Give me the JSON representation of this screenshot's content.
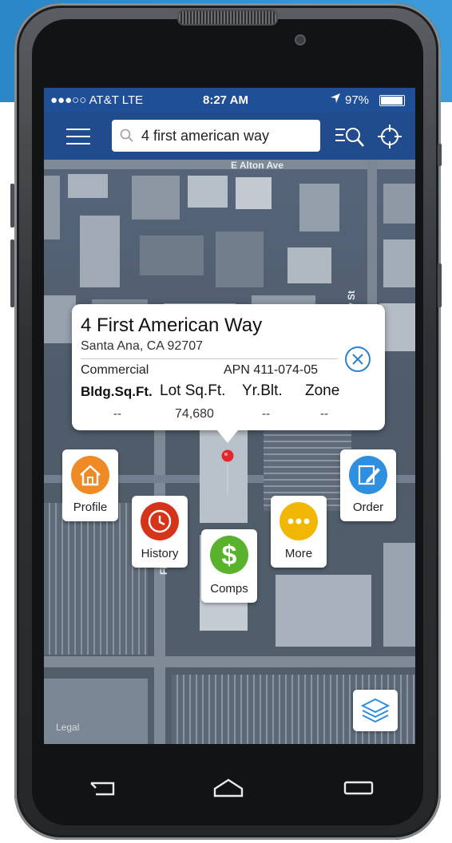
{
  "status_bar": {
    "carrier": "●●●○○ AT&T  LTE",
    "time": "8:27 AM",
    "battery": "97%"
  },
  "search": {
    "value": "4 first american way"
  },
  "map": {
    "street_top": "E Alton Ave",
    "street_side": "laday St",
    "street_first": "First",
    "legal": "Legal"
  },
  "property": {
    "title": "4 First American Way",
    "city": "Santa Ana, CA 92707",
    "type": "Commercial",
    "apn": "APN 411-074-05",
    "headers": {
      "bldg": "Bldg.Sq.Ft.",
      "lot": "Lot Sq.Ft.",
      "year": "Yr.Blt.",
      "zone": "Zone"
    },
    "values": {
      "bldg": "--",
      "lot": "74,680",
      "year": "--",
      "zone": "--"
    }
  },
  "actions": {
    "profile": "Profile",
    "history": "History",
    "comps": "Comps",
    "more": "More",
    "order": "Order"
  },
  "colors": {
    "toolbar": "#1a4a93",
    "profile": "#f08a24",
    "history": "#d6341a",
    "comps": "#58b22b",
    "more": "#f2b705",
    "order": "#2e8ee0"
  },
  "icons": [
    "menu-icon",
    "search-icon",
    "list-search-icon",
    "locate-icon",
    "house-icon",
    "clock-icon",
    "dollar-icon",
    "ellipsis-icon",
    "edit-icon",
    "layers-icon",
    "close-icon"
  ]
}
